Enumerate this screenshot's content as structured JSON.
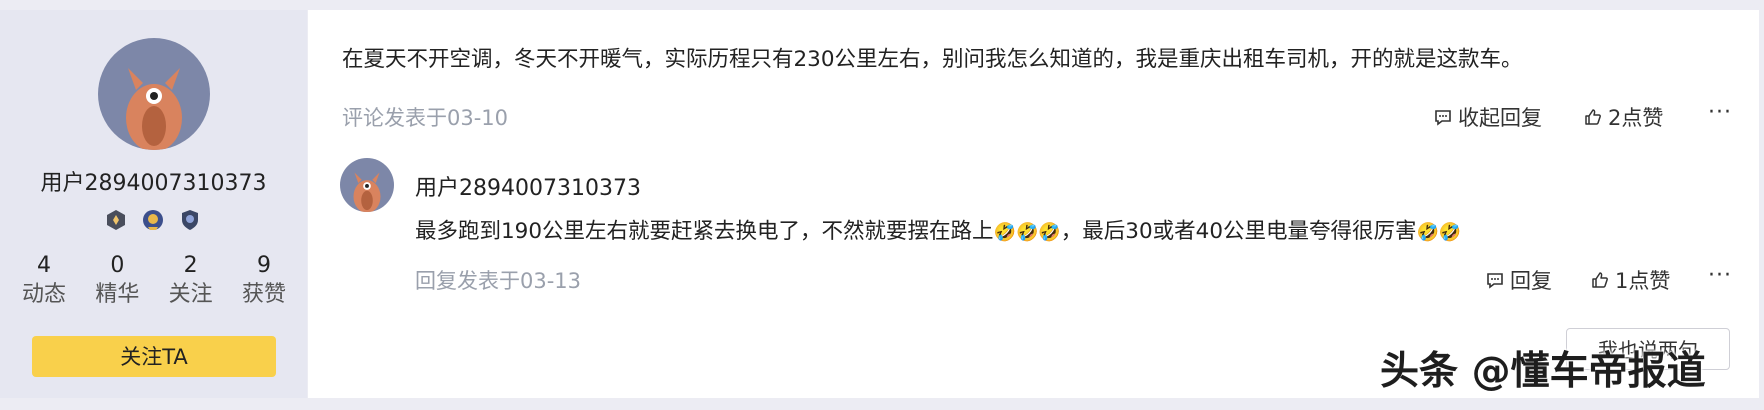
{
  "sidebar": {
    "username": "用户2894007310373",
    "badges": [
      "rank-badge-icon",
      "medal-badge-icon",
      "shield-badge-icon"
    ],
    "stats": [
      {
        "num": "4",
        "label": "动态"
      },
      {
        "num": "0",
        "label": "精华"
      },
      {
        "num": "2",
        "label": "关注"
      },
      {
        "num": "9",
        "label": "获赞"
      }
    ],
    "follow_label": "关注TA"
  },
  "comment": {
    "text": "在夏天不开空调，冬天不开暖气，实际历程只有230公里左右，别问我怎么知道的，我是重庆出租车司机，开的就是这款车。",
    "meta": "评论发表于03-10",
    "collapse_label": "收起回复",
    "likes_label": "2点赞",
    "more_label": "···"
  },
  "reply": {
    "username": "用户2894007310373",
    "text_part1": "最多跑到190公里左右就要赶紧去换电了，不然就要摆在路上",
    "emoji_group1": "🤣🤣🤣",
    "text_part2": "，最后30或者40公里电量夸得很厉害",
    "emoji_group2": "🤣🤣",
    "meta": "回复发表于03-13",
    "reply_label": "回复",
    "likes_label": "1点赞",
    "more_label": "···"
  },
  "say_button_label": "我也说两句",
  "watermark": "头条 @懂车帝报道",
  "colors": {
    "sidebar_bg": "#e6e7f1",
    "follow_button": "#f9d04b",
    "meta_text": "#9aa0ac",
    "avatar_bg": "#7d87a8",
    "avatar_figure": "#d9835e"
  }
}
